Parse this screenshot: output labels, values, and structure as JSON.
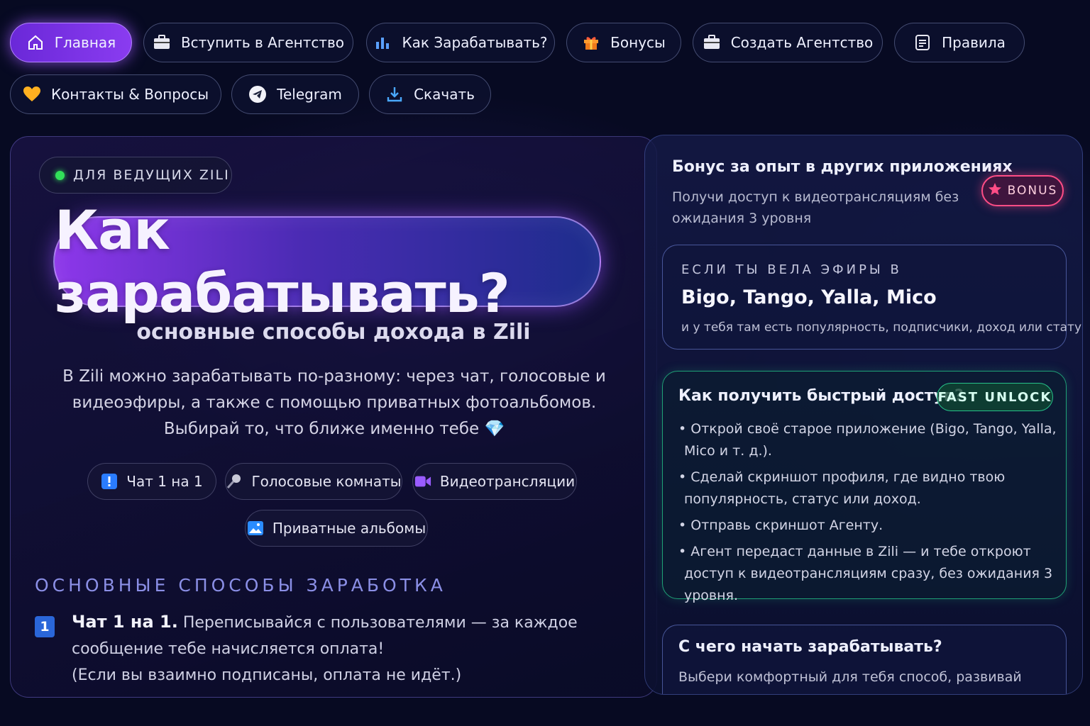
{
  "nav": {
    "home": "Главная",
    "join_agency": "Вступить в Агентство",
    "how_to_earn": "Как Зарабатывать?",
    "bonuses": "Бонусы",
    "create_agency": "Создать Агентство",
    "rules": "Правила",
    "contacts": "Контакты & Вопросы",
    "telegram": "Telegram",
    "download": "Скачать"
  },
  "main": {
    "tag": "ДЛЯ ВЕДУЩИХ ZILI",
    "title": "Как зарабатывать?",
    "subtitle": "основные способы дохода в Zili",
    "intro": "В Zili можно зарабатывать по-разному: через чат, голосовые и видеоэфиры, а также с помощью приватных фотоальбомов. Выбирай то, что ближе именно тебе 💎",
    "chips": {
      "chat": "Чат 1 на 1",
      "voice": "Голосовые комнаты",
      "video": "Видеотрансляции",
      "albums": "Приватные альбомы"
    },
    "section_title": "ОСНОВНЫЕ СПОСОБЫ ЗАРАБОТКА",
    "way1": {
      "num": "1",
      "bold": "Чат 1 на 1.",
      "text": " Переписывайся с пользователями — за каждое сообщение тебе начисляется оплата!",
      "note": "(Если вы взаимно подписаны, оплата не идёт.)"
    }
  },
  "side": {
    "bonus_title": "Бонус за опыт в других приложениях",
    "bonus_desc": "Получи доступ к видеотрансляциям без ожидания 3 уровня",
    "bonus_badge": "BONUS",
    "apps_label": "ЕСЛИ ТЫ ВЕЛА ЭФИРЫ В",
    "apps_names": "Bigo, Tango, Yalla, Mico",
    "apps_desc": "и у тебя там есть популярность, подписчики, доход или статус",
    "fast_title": "Как получить быстрый доступ?",
    "fast_badge": "FAST UNLOCK",
    "fast_steps": [
      "• Открой своё старое приложение (Bigo, Tango, Yalla, Mico и т. д.).",
      "• Сделай скриншот профиля, где видно твою популярность, статус или доход.",
      "• Отправь скриншот Агенту.",
      "• Агент передаст данные в Zili — и тебе откроют доступ к видеотрансляциям сразу, без ожидания 3 уровня."
    ],
    "start_title": "С чего начать зарабатывать?",
    "start_desc": "Выбери комфортный для тебя способ, развивай"
  }
}
